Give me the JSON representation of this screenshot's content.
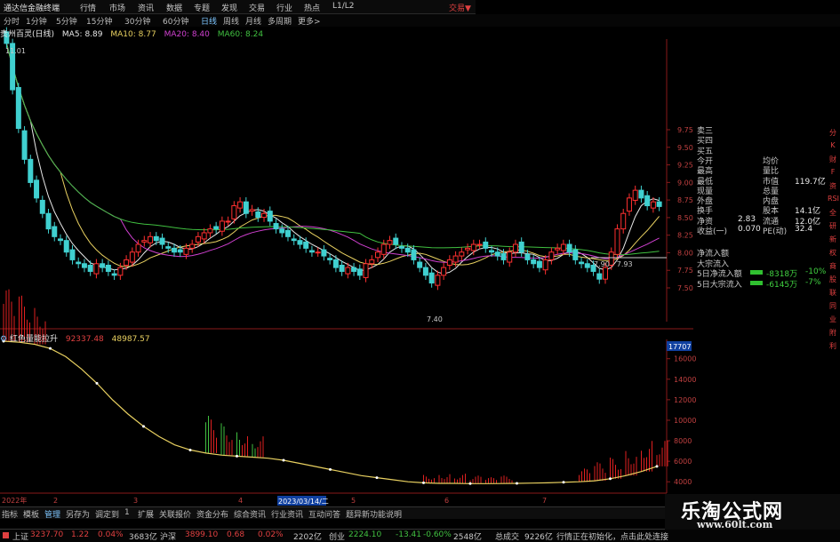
{
  "menubar": {
    "app_name": "通达信金融终端",
    "items": [
      "行情",
      "市场",
      "资讯",
      "数据",
      "专题",
      "发现",
      "交易",
      "行业",
      "热点",
      "L1/L2"
    ],
    "trade_label": "交易▼"
  },
  "periods": [
    "分时",
    "1分钟",
    "5分钟",
    "15分钟",
    "30分钟",
    "60分钟",
    "日线",
    "周线",
    "月线",
    "多周期",
    "更多>"
  ],
  "active_period": "日线",
  "stock_title": "贵州百灵(日线)",
  "ma_legend": [
    {
      "label": "MA5: 8.89",
      "color": "#e8e8e8"
    },
    {
      "label": "MA10: 8.77",
      "color": "#e8d060"
    },
    {
      "label": "MA20: 8.40",
      "color": "#d040d0"
    },
    {
      "label": "MA60: 8.24",
      "color": "#40c040"
    }
  ],
  "price_axis": [
    "9.75",
    "9.50",
    "9.25",
    "9.00",
    "8.75",
    "8.50",
    "8.25",
    "8.00",
    "7.75",
    "7.50"
  ],
  "price_annotations": {
    "high": "11.01",
    "low": "7.40",
    "range": "7.90 - 7.93"
  },
  "indicator_title": "红色量能拉升",
  "indicator_values": [
    {
      "label": "92337.48",
      "color": "#e04040"
    },
    {
      "label": "48987.57",
      "color": "#e8d060"
    }
  ],
  "indicator_axis": [
    "16000",
    "14000",
    "12000",
    "10000",
    "8000",
    "6000",
    "4000"
  ],
  "indicator_top": "17707",
  "x_ticks": [
    "2022年",
    "2",
    "3",
    "4",
    "5",
    "6",
    "7"
  ],
  "cursor_date": "2023/03/14/二",
  "quote_panel": {
    "rows": [
      {
        "l": "卖三",
        "v": "",
        "l2": "",
        "v2": ""
      },
      {
        "l": "买四",
        "v": "",
        "l2": "",
        "v2": ""
      },
      {
        "l": "买五",
        "v": "",
        "l2": "",
        "v2": ""
      },
      {
        "l": "今开",
        "v": "",
        "l2": "均价",
        "v2": ""
      },
      {
        "l": "最高",
        "v": "",
        "l2": "量比",
        "v2": ""
      },
      {
        "l": "最低",
        "v": "",
        "l2": "市值",
        "v2": "119.7亿"
      },
      {
        "l": "现量",
        "v": "",
        "l2": "总量",
        "v2": ""
      },
      {
        "l": "外盘",
        "v": "",
        "l2": "内盘",
        "v2": ""
      },
      {
        "l": "换手",
        "v": "",
        "l2": "股本",
        "v2": "14.1亿"
      },
      {
        "l": "净资",
        "v": "2.83",
        "l2": "流通",
        "v2": "12.0亿"
      },
      {
        "l": "收益(一)",
        "v": "0.070",
        "l2": "PE(动)",
        "v2": "32.4"
      }
    ],
    "flows": [
      {
        "l": "净流入额",
        "v": "",
        "p": ""
      },
      {
        "l": "大宗流入",
        "v": "",
        "p": ""
      },
      {
        "l": "5日净流入额",
        "v": "-8318万",
        "p": "-10%"
      },
      {
        "l": "5日大宗流入",
        "v": "-6145万",
        "p": "-7%"
      }
    ]
  },
  "sidebar": [
    "分",
    "K",
    "财",
    "F",
    "资",
    "RSI",
    "全",
    "研",
    "新",
    "权",
    "商",
    "股",
    "联",
    "同",
    "业",
    "附",
    "利"
  ],
  "bottom_tabs": [
    "指标",
    "模板",
    "管理",
    "另存为",
    "调定到",
    "1",
    "扩展",
    "关联报价",
    "资金分布",
    "综合资讯",
    "行业资讯",
    "互动问答",
    "题异新功能说明"
  ],
  "right_bottom": "图交F10 ◆",
  "statusbar": [
    {
      "t": "上证",
      "c": "#c8c8c8"
    },
    {
      "t": "3237.70",
      "c": "#e04040"
    },
    {
      "t": "1.22",
      "c": "#e04040"
    },
    {
      "t": "0.04%",
      "c": "#e04040"
    },
    {
      "t": "3683亿",
      "c": "#c8c8c8"
    },
    {
      "t": "沪深",
      "c": "#c8c8c8"
    },
    {
      "t": "3899.10",
      "c": "#e04040"
    },
    {
      "t": "0.68",
      "c": "#e04040"
    },
    {
      "t": "0.02%",
      "c": "#e04040"
    },
    {
      "t": "2202亿",
      "c": "#c8c8c8"
    },
    {
      "t": "创业",
      "c": "#c8c8c8"
    },
    {
      "t": "2224.10",
      "c": "#40c040"
    },
    {
      "t": "-13.41",
      "c": "#40c040"
    },
    {
      "t": "-0.60%",
      "c": "#40c040"
    },
    {
      "t": "2548亿",
      "c": "#c8c8c8"
    },
    {
      "t": "总成交",
      "c": "#c8c8c8"
    },
    {
      "t": "9226亿",
      "c": "#c8c8c8"
    },
    {
      "t": "行情正在初始化，点击此处连接",
      "c": "#c8c8c8"
    }
  ],
  "watermark": {
    "cn": "乐淘公式网",
    "url": "www.60lt.com"
  },
  "chart_data": [
    {
      "type": "candlestick",
      "title": "贵州百灵(日线)",
      "ylim": [
        7.4,
        11.01
      ],
      "closes": [
        11.0,
        10.4,
        9.9,
        9.5,
        9.2,
        9.0,
        8.8,
        8.6,
        8.5,
        8.45,
        8.3,
        8.2,
        8.15,
        8.1,
        8.05,
        8.15,
        8.1,
        8.05,
        8.0,
        8.1,
        8.2,
        8.3,
        8.4,
        8.45,
        8.5,
        8.45,
        8.4,
        8.35,
        8.3,
        8.3,
        8.35,
        8.4,
        8.5,
        8.55,
        8.6,
        8.6,
        8.7,
        8.7,
        8.9,
        8.95,
        8.8,
        8.85,
        8.75,
        8.8,
        8.7,
        8.6,
        8.55,
        8.5,
        8.45,
        8.4,
        8.35,
        8.3,
        8.3,
        8.25,
        8.2,
        8.1,
        8.05,
        8.1,
        8.05,
        8.0,
        8.15,
        8.2,
        8.3,
        8.4,
        8.45,
        8.4,
        8.35,
        8.3,
        8.2,
        8.1,
        8.0,
        7.9,
        8.0,
        8.1,
        8.2,
        8.25,
        8.3,
        8.35,
        8.4,
        8.4,
        8.35,
        8.3,
        8.25,
        8.2,
        8.3,
        8.4,
        8.3,
        8.2,
        8.15,
        8.1,
        8.2,
        8.3,
        8.35,
        8.4,
        8.3,
        8.2,
        8.15,
        8.1,
        8.05,
        7.95,
        8.1,
        8.3,
        8.6,
        8.8,
        9.0,
        9.1,
        9.0,
        8.9,
        8.95,
        8.89
      ],
      "ma": [
        "MA5",
        "MA10",
        "MA20",
        "MA60"
      ]
    },
    {
      "type": "area",
      "title": "红色量能拉升",
      "ylim": [
        3500,
        17707
      ],
      "line": [
        17707,
        17600,
        17400,
        17000,
        16200,
        15000,
        13600,
        12000,
        10600,
        9400,
        8400,
        7600,
        7100,
        6800,
        6600,
        6500,
        6400,
        6300,
        6100,
        5800,
        5500,
        5200,
        4900,
        4600,
        4400,
        4200,
        4000,
        3900,
        3850,
        3850,
        3820,
        3820,
        3830,
        3850,
        3870,
        3900,
        3950,
        4000,
        4100,
        4300,
        4600,
        5000,
        5500
      ],
      "bars": [
        [
          0,
          1.0
        ],
        [
          1,
          0.9
        ],
        [
          2,
          0.7
        ],
        [
          13,
          0.7
        ],
        [
          14,
          0.6
        ],
        [
          15,
          0.5
        ],
        [
          16,
          0.4
        ],
        [
          27,
          0.15
        ],
        [
          28,
          0.2
        ],
        [
          29,
          0.18
        ],
        [
          30,
          0.15
        ],
        [
          31,
          0.12
        ],
        [
          32,
          0.15
        ],
        [
          37,
          0.25
        ],
        [
          38,
          0.35
        ],
        [
          39,
          0.4
        ],
        [
          40,
          0.5
        ],
        [
          41,
          0.6
        ],
        [
          42,
          0.5
        ]
      ]
    }
  ]
}
